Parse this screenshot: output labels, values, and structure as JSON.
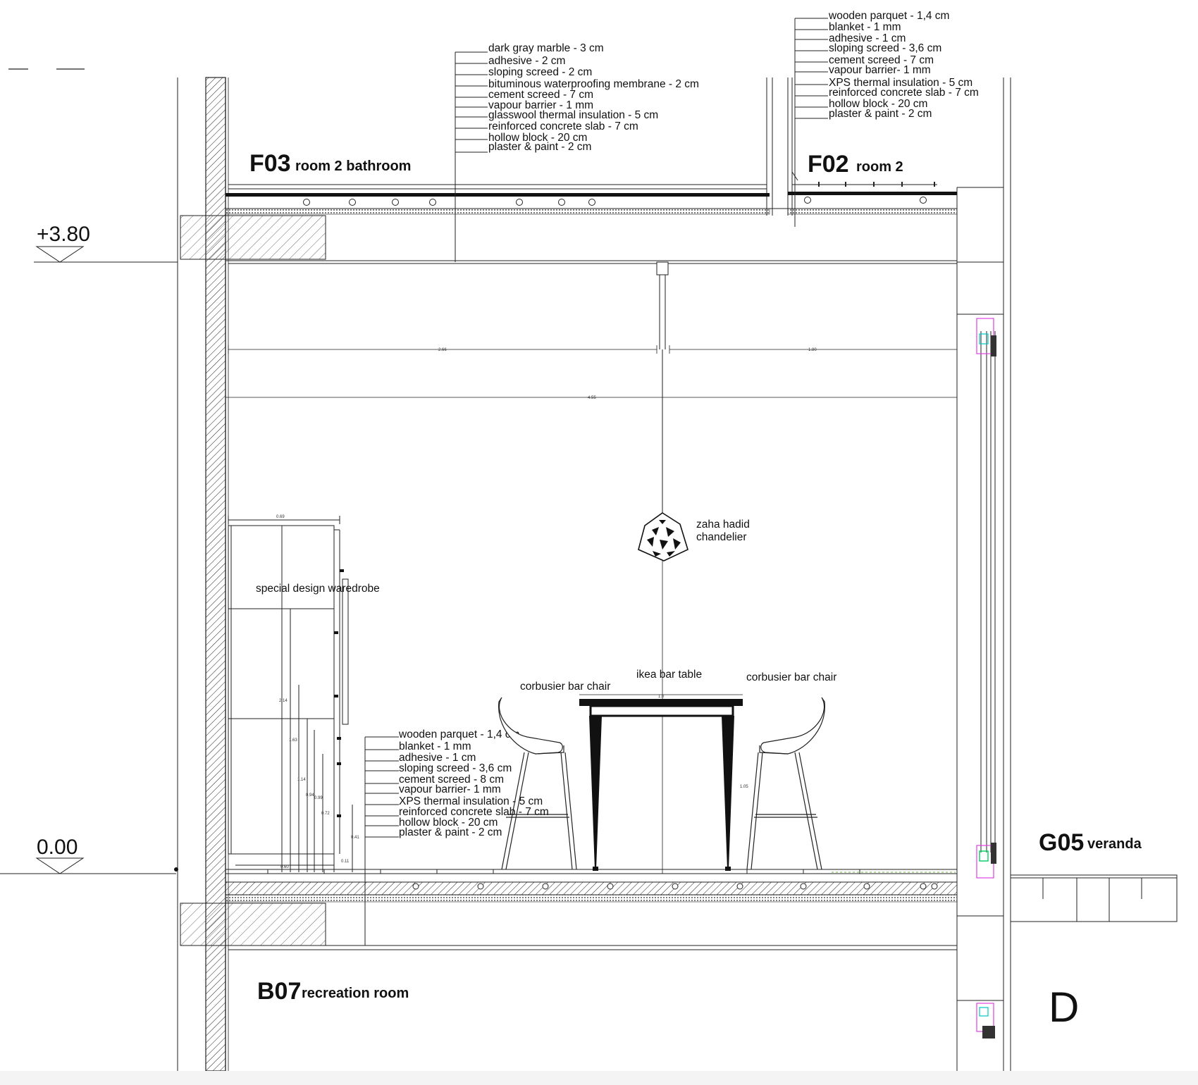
{
  "rooms": {
    "f03": {
      "code": "F03",
      "name": "room 2 bathroom"
    },
    "f02": {
      "code": "F02",
      "name": "room 2"
    },
    "g05": {
      "code": "G05",
      "name": "veranda"
    },
    "b07": {
      "code": "B07",
      "name": "recreation room"
    }
  },
  "levels": {
    "upper": "+3.80",
    "ground": "0.00"
  },
  "grid_label": "D",
  "layers": {
    "f03": [
      "dark gray marble - 3 cm",
      "adhesive - 2 cm",
      "sloping screed - 2 cm",
      "bituminous waterproofing membrane - 2 cm",
      "cement screed - 7 cm",
      "vapour barrier - 1 mm",
      "glasswool thermal insulation - 5 cm",
      "reinforced concrete slab - 7 cm",
      "hollow block - 20 cm",
      "plaster & paint - 2 cm"
    ],
    "f02": [
      "wooden parquet - 1,4 cm",
      "blanket - 1 mm",
      "adhesive - 1 cm",
      "sloping screed - 3,6 cm",
      "cement screed - 7 cm",
      "vapour barrier- 1 mm",
      "XPS thermal insulation - 5 cm",
      "reinforced concrete slab - 7 cm",
      "hollow block - 20 cm",
      "plaster & paint - 2 cm"
    ],
    "ground": [
      "wooden parquet - 1,4 cm",
      "blanket - 1 mm",
      "adhesive - 1 cm",
      "sloping screed - 3,6 cm",
      "cement screed - 8 cm",
      "vapour barrier- 1 mm",
      "XPS thermal insulation - 5 cm",
      "reinforced concrete slab - 7 cm",
      "hollow block - 20 cm",
      "plaster & paint - 2 cm"
    ]
  },
  "labels": {
    "chandelier": [
      "zaha hadid",
      "chandelier"
    ],
    "wardrobe": "special design waredrobe",
    "table": "ikea bar table",
    "chair_left": "corbusier bar chair",
    "chair_right": "corbusier bar chair"
  },
  "dimensions": {
    "span_left": "2.66",
    "span_right": "1.80",
    "span_total": "4.55",
    "wardrobe_width": "0.69",
    "wardrobe_height": "2.14",
    "dim_163": "1.63",
    "dim_114": "1.14",
    "dim_094": "0.94",
    "dim_099": "0.99",
    "dim_072": "0.72",
    "dim_041": "0.41",
    "dim_011": "0.11",
    "dim_060": "0.60",
    "table_width": "1.0",
    "table_height": "1.05"
  }
}
